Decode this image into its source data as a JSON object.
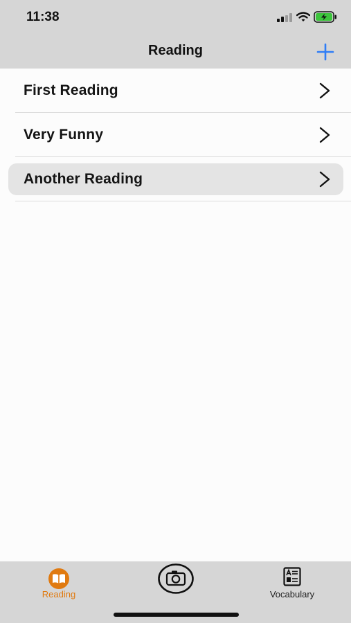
{
  "status_bar": {
    "time": "11:38"
  },
  "nav": {
    "title": "Reading",
    "add_icon": "plus-icon"
  },
  "list": {
    "items": [
      {
        "label": "First Reading",
        "selected": false
      },
      {
        "label": "Very Funny",
        "selected": false
      },
      {
        "label": "Another Reading",
        "selected": true
      }
    ]
  },
  "tab_bar": {
    "tabs": [
      {
        "label": "Reading",
        "icon": "book-icon",
        "active": true
      },
      {
        "label": "",
        "icon": "camera-icon",
        "active": false
      },
      {
        "label": "Vocabulary",
        "icon": "vocabulary-icon",
        "active": false
      }
    ]
  },
  "colors": {
    "accent_blue": "#2f7df6",
    "active_tab": "#e07a10",
    "bar_background": "#d6d6d6",
    "battery_green": "#3cc43c"
  }
}
